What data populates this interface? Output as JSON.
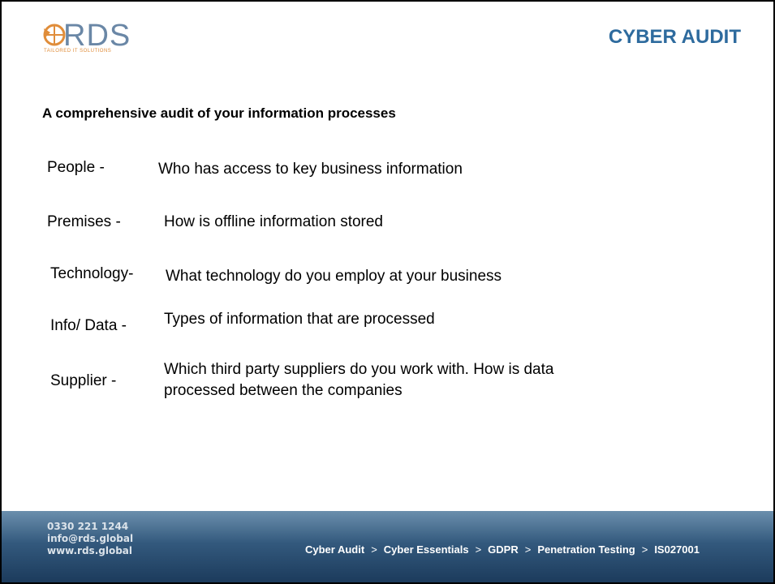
{
  "header": {
    "logo_text": "RDS",
    "logo_tagline": "TAILORED IT SOLUTIONS",
    "title": "CYBER AUDIT"
  },
  "main": {
    "subtitle": "A comprehensive audit of your information processes",
    "rows": [
      {
        "term": "People -",
        "description": "Who has access to key business information"
      },
      {
        "term": "Premises -",
        "description": "How is offline information stored"
      },
      {
        "term": "Technology-",
        "description": "What technology do you employ at your business"
      },
      {
        "term": "Info/ Data -",
        "description": "Types of information that are processed"
      },
      {
        "term": "Supplier -",
        "description_line1": "Which third party suppliers do you work with. How is data",
        "description_line2": "processed between the companies"
      }
    ]
  },
  "footer": {
    "phone": "0330 221 1244",
    "email": "info@rds.global",
    "website": "www.rds.global",
    "services": [
      "Cyber Audit",
      "Cyber Essentials",
      "GDPR",
      "Penetration Testing",
      "IS027001"
    ],
    "separator": ">"
  },
  "colors": {
    "title": "#2e6b9e",
    "logo": "#6a87a6",
    "footer_top": "#6b8fad",
    "footer_bottom": "#1c3b5c"
  }
}
